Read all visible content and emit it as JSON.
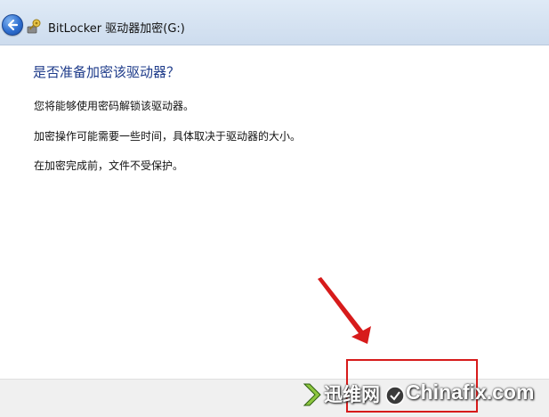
{
  "window": {
    "title": "BitLocker 驱动器加密(G:)",
    "back_icon": "back-arrow-icon",
    "app_icon": "bitlocker-key-icon"
  },
  "content": {
    "heading": "是否准备加密该驱动器？",
    "paragraphs": [
      "您将能够使用密码解锁该驱动器。",
      "加密操作可能需要一些时间，具体取决于驱动器的大小。",
      "在加密完成前，文件不受保护。"
    ]
  },
  "annotation": {
    "arrow_color": "#d71b1b",
    "box_color": "#d71b1b"
  },
  "watermark": {
    "cn_text": "迅维网",
    "en_text": "Chinafix.com"
  },
  "colors": {
    "heading": "#1e3b8a",
    "titlebar": "#dfeaf6",
    "footer": "#f0f0f0"
  }
}
